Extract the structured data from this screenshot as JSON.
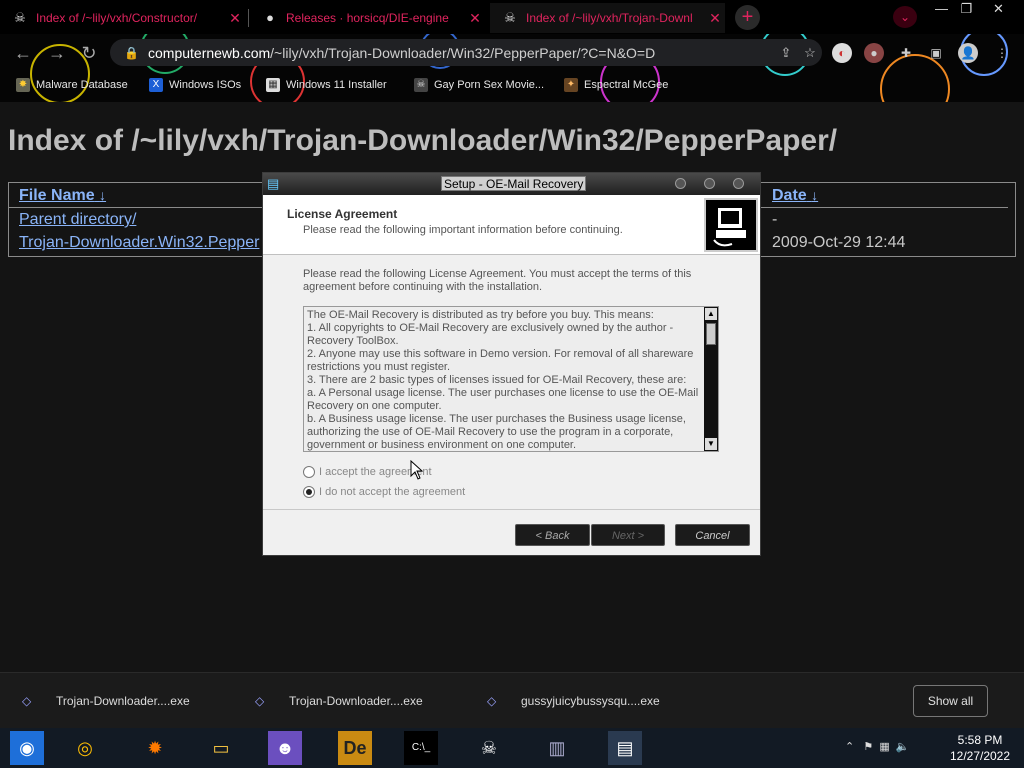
{
  "browser": {
    "tabs": [
      {
        "title": "Index of /~lily/vxh/Constructor/",
        "active": false
      },
      {
        "title": "Releases · horsicq/DIE-engine",
        "active": false
      },
      {
        "title": "Index of /~lily/vxh/Trojan-Downl",
        "active": true
      }
    ],
    "new_tab_label": "+",
    "url_host": "computernewb.com",
    "url_path": "/~lily/vxh/Trojan-Downloader/Win32/PepperPaper/?C=N&O=D",
    "bookmarks": [
      {
        "label": "Malware Database",
        "icon": "bug-icon"
      },
      {
        "label": "Windows ISOs",
        "icon": "x-logo-icon"
      },
      {
        "label": "Windows 11 Installer",
        "icon": "windows-icon"
      },
      {
        "label": "Gay Porn Sex Movie...",
        "icon": "globe-icon"
      },
      {
        "label": "Espectral McGee",
        "icon": "fox-icon"
      }
    ]
  },
  "page": {
    "title": "Index of /~lily/vxh/Trojan-Downloader/Win32/PepperPaper/",
    "columns": {
      "file_name": "File Name",
      "file_name_sort": "↓",
      "date": "Date",
      "date_sort": "↓"
    },
    "rows": [
      {
        "name": "Parent directory/",
        "date": "-"
      },
      {
        "name": "Trojan-Downloader.Win32.Pepper",
        "date": "2009-Oct-29 12:44"
      }
    ]
  },
  "dialog": {
    "title": "Setup - OE-Mail Recovery",
    "header_title": "License Agreement",
    "header_subtitle": "Please read the following important information before continuing.",
    "intro": "Please read the following License Agreement. You must accept the terms of this agreement before continuing with the installation.",
    "license_lines": [
      "The OE-Mail Recovery is distributed as try before you buy. This means:",
      "1. All copyrights to OE-Mail Recovery are exclusively owned by the author - Recovery ToolBox.",
      "2. Anyone may use this software in Demo version. For removal of all shareware restrictions you must register.",
      "3. There are 2 basic types of licenses issued for OE-Mail Recovery, these are:",
      "a. A Personal usage license. The user purchases one license to use the OE-Mail Recovery on one computer.",
      "b. A Business usage license. The user purchases the Business usage license, authorizing the use of OE-Mail Recovery to use the program in a corporate, government or business environment on one computer."
    ],
    "radio_accept": "I accept the agreement",
    "radio_decline": "I do not accept the agreement",
    "selected": "decline",
    "btn_back": "< Back",
    "btn_next": "Next >",
    "btn_cancel": "Cancel"
  },
  "downloads": {
    "items": [
      "Trojan-Downloader....exe",
      "Trojan-Downloader....exe",
      "gussyjuicybussysqu....exe"
    ],
    "show_all": "Show all"
  },
  "taskbar": {
    "time": "5:58 PM",
    "date": "12/27/2022"
  },
  "colors": {
    "accent": "#e0245e",
    "link": "#8ab4f8"
  }
}
